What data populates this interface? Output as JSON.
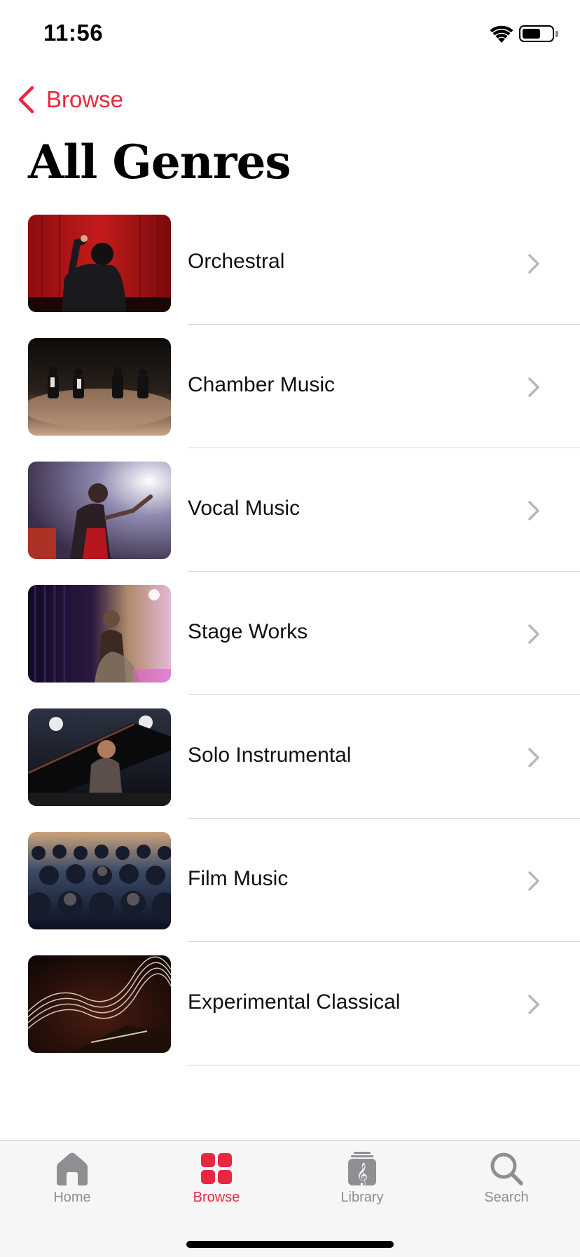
{
  "status_bar": {
    "time": "11:56"
  },
  "nav": {
    "back_label": "Browse",
    "title": "All Genres"
  },
  "genres": [
    {
      "label": "Orchestral",
      "image": "conductor-red-curtain"
    },
    {
      "label": "Chamber Music",
      "image": "string-quartet-stage"
    },
    {
      "label": "Vocal Music",
      "image": "singer-red-dress"
    },
    {
      "label": "Stage Works",
      "image": "ballet-backstage"
    },
    {
      "label": "Solo Instrumental",
      "image": "pianist-spotlight"
    },
    {
      "label": "Film Music",
      "image": "audience-seats"
    },
    {
      "label": "Experimental Classical",
      "image": "light-trails-piano"
    }
  ],
  "tabs": [
    {
      "label": "Home",
      "icon": "home-icon",
      "active": false
    },
    {
      "label": "Browse",
      "icon": "grid-icon",
      "active": true
    },
    {
      "label": "Library",
      "icon": "library-icon",
      "active": false
    },
    {
      "label": "Search",
      "icon": "search-icon",
      "active": false
    }
  ],
  "colors": {
    "accent": "#e8283f",
    "inactive": "#8e8e93",
    "separator": "#d4d4d6",
    "tab_bar_bg": "#f6f6f6"
  }
}
